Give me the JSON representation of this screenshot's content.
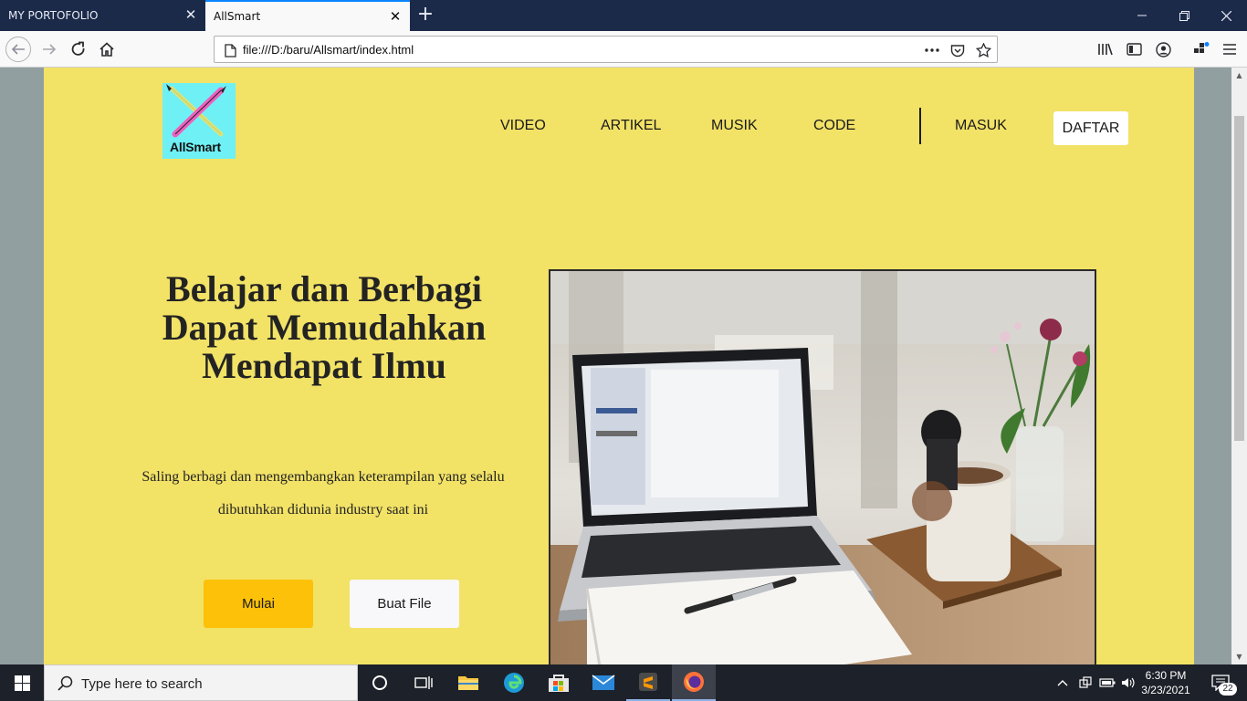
{
  "browser": {
    "tabs": [
      {
        "title": "MY PORTOFOLIO",
        "active": false
      },
      {
        "title": "AllSmart",
        "active": true
      }
    ],
    "url": "file:///D:/baru/Allsmart/index.html"
  },
  "site": {
    "logo_text": "AllSmart",
    "nav": [
      "VIDEO",
      "ARTIKEL",
      "MUSIK",
      "CODE"
    ],
    "login_label": "MASUK",
    "register_label": "DAFTAR",
    "hero": {
      "title": "Belajar dan Berbagi Dapat Memudahkan Mendapat Ilmu",
      "subtitle": "Saling berbagi dan mengembangkan keterampilan yang selalu dibutuhkan didunia industry saat ini",
      "primary_button": "Mulai",
      "secondary_button": "Buat File"
    },
    "colors": {
      "page_bg": "#f2e266",
      "primary_button": "#fdc109",
      "logo_bg": "#6ef0f5"
    }
  },
  "taskbar": {
    "search_placeholder": "Type here to search",
    "time": "6:30 PM",
    "date": "3/23/2021",
    "notification_count": "22"
  }
}
